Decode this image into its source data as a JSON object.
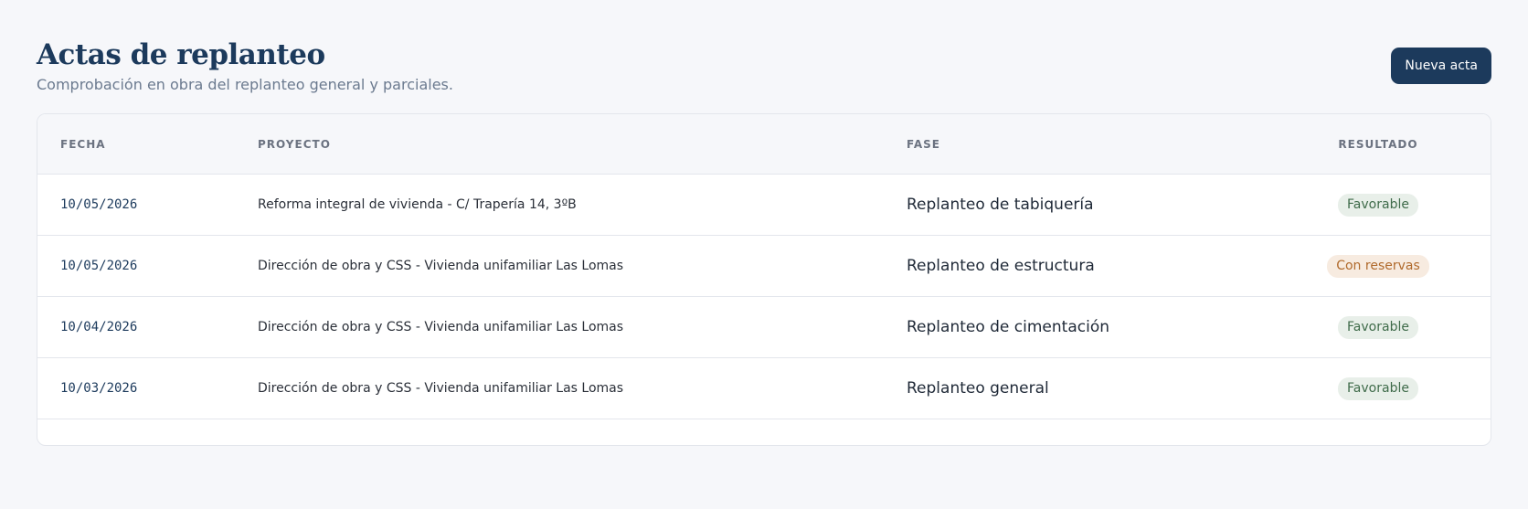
{
  "header": {
    "title": "Actas de replanteo",
    "subtitle": "Comprobación en obra del replanteo general y parciales.",
    "new_button_label": "Nueva acta"
  },
  "table": {
    "columns": {
      "fecha": "FECHA",
      "proyecto": "PROYECTO",
      "fase": "FASE",
      "resultado": "RESULTADO"
    },
    "rows": [
      {
        "fecha": "10/05/2026",
        "proyecto": "Reforma integral de vivienda - C/ Trapería 14, 3ºB",
        "fase": "Replanteo de tabiquería",
        "resultado": "Favorable",
        "status": "ok"
      },
      {
        "fecha": "10/05/2026",
        "proyecto": "Dirección de obra y CSS - Vivienda unifamiliar Las Lomas",
        "fase": "Replanteo de estructura",
        "resultado": "Con reservas",
        "status": "warn"
      },
      {
        "fecha": "10/04/2026",
        "proyecto": "Dirección de obra y CSS - Vivienda unifamiliar Las Lomas",
        "fase": "Replanteo de cimentación",
        "resultado": "Favorable",
        "status": "ok"
      },
      {
        "fecha": "10/03/2026",
        "proyecto": "Dirección de obra y CSS - Vivienda unifamiliar Las Lomas",
        "fase": "Replanteo general",
        "resultado": "Favorable",
        "status": "ok"
      }
    ]
  },
  "colors": {
    "brand": "#1c3a5c",
    "ok_bg": "#e8efe9",
    "ok_text": "#3f6b4a",
    "warn_bg": "#f7ebe0",
    "warn_text": "#b06a2c"
  }
}
